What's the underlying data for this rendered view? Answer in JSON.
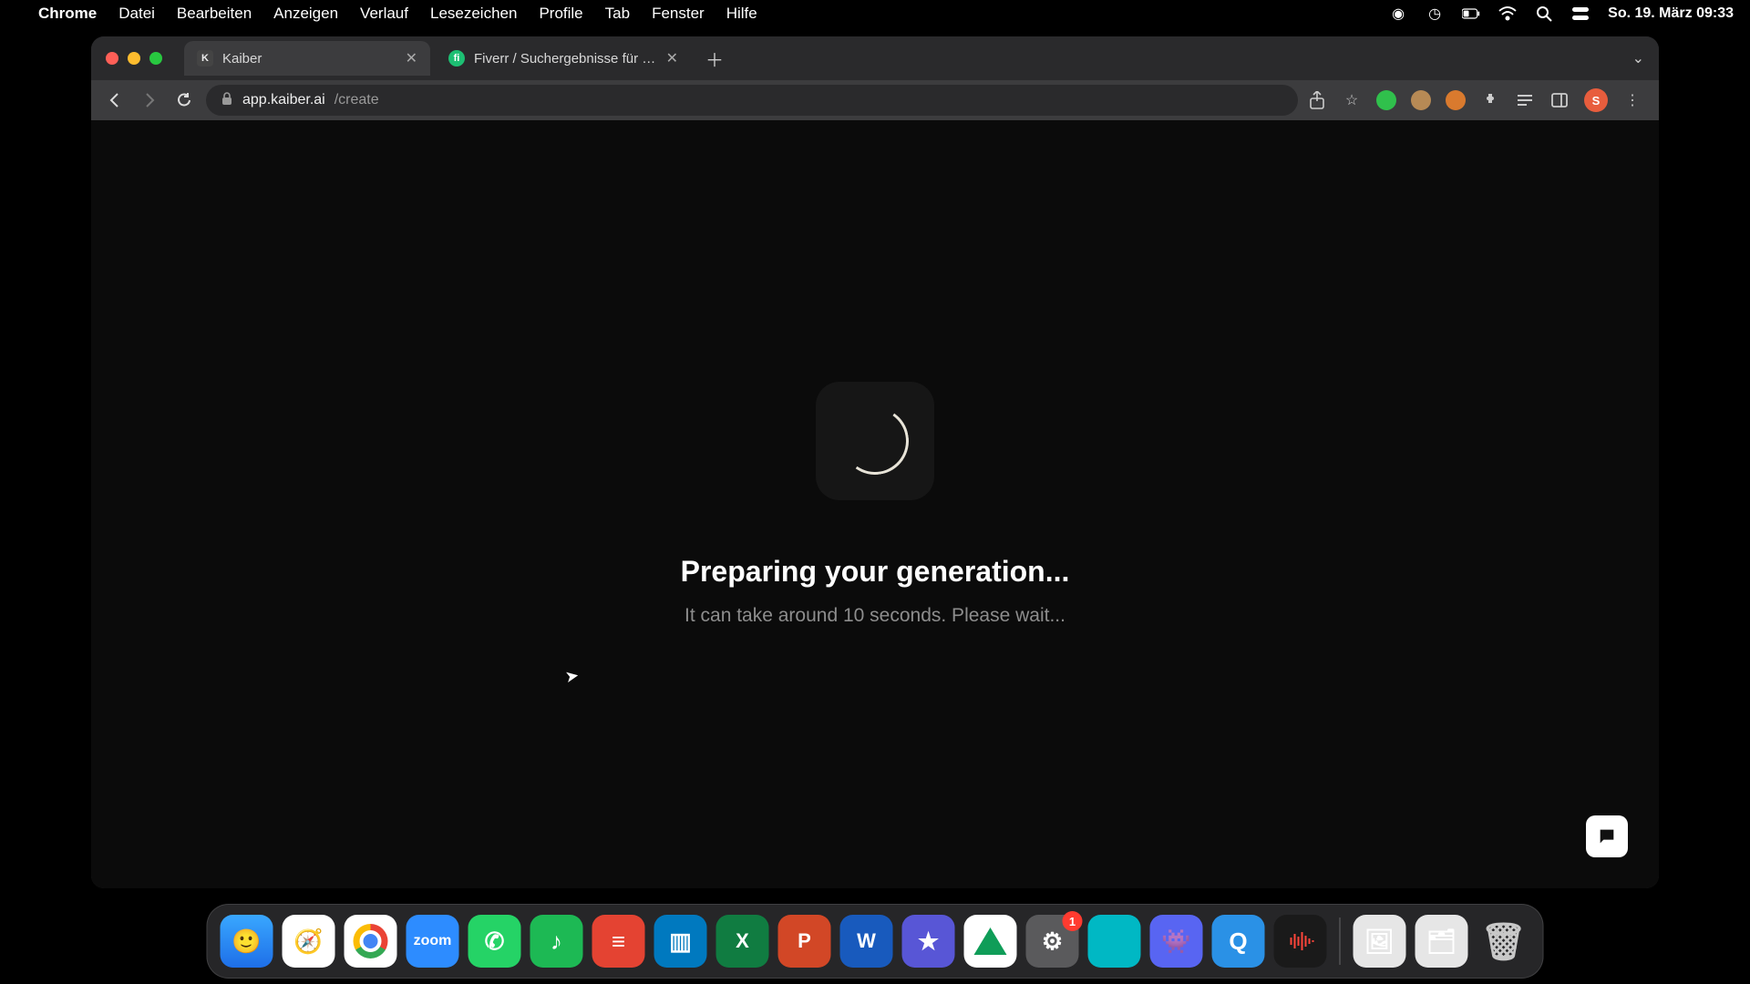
{
  "menubar": {
    "app": "Chrome",
    "items": [
      "Datei",
      "Bearbeiten",
      "Anzeigen",
      "Verlauf",
      "Lesezeichen",
      "Profile",
      "Tab",
      "Fenster",
      "Hilfe"
    ],
    "datetime": "So. 19. März  09:33"
  },
  "tabs": [
    {
      "favicon": "K",
      "title": "Kaiber",
      "active": true
    },
    {
      "favicon": "fi",
      "title": "Fiverr / Suchergebnisse für „lo",
      "active": false
    }
  ],
  "address": {
    "host": "app.kaiber.ai",
    "path": "/create"
  },
  "profile_initial": "S",
  "page": {
    "heading": "Preparing your generation...",
    "subtext": "It can take around 10 seconds. Please wait..."
  },
  "dock": {
    "settings_badge": "1",
    "zoom_label": "zoom",
    "excel_label": "X",
    "ppt_label": "P",
    "word_label": "W",
    "imovie_label": "★"
  }
}
